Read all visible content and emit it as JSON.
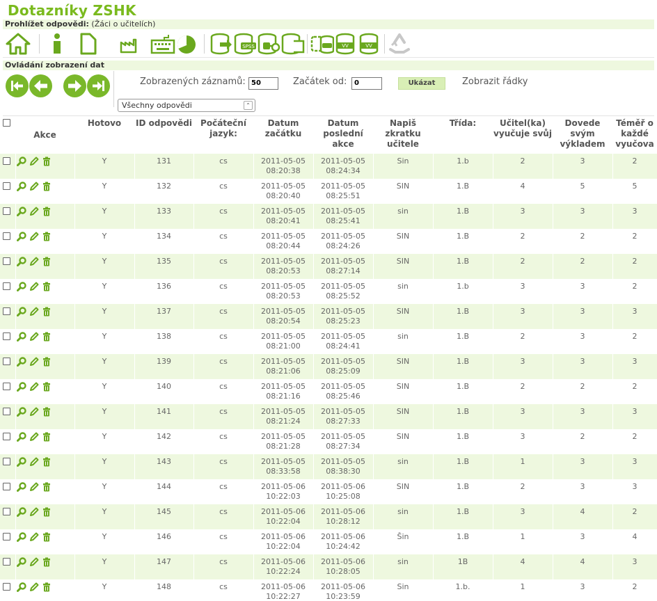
{
  "app_title": "Dotazníky ZSHK",
  "browse_bar": {
    "label": "Prohlížet odpovědi:",
    "context": "(Žáci o učitelích)"
  },
  "view_bar": {
    "label": "Ovládání zobrazení dat"
  },
  "controls": {
    "records_label": "Zobrazených záznamů:",
    "records_value": "50",
    "start_label": "Začátek od:",
    "start_value": "0",
    "show_button": "Ukázat",
    "rows_label": "Zobrazit řádky",
    "filter_selected": "Všechny odpovědi"
  },
  "colors": {
    "accent": "#7ab82a",
    "row_alt": "#eef8df",
    "title": "#7aba1e"
  },
  "toolbar_icons": [
    "home-icon",
    "info-icon",
    "document-icon",
    "factory-icon",
    "keyboard-icon",
    "pie-chart-icon",
    "export-database-icon",
    "spss-export-icon",
    "r-export-icon",
    "import-database-icon",
    "vv-database-icon",
    "vv-database-icon-2",
    "recycle-icon"
  ],
  "table": {
    "headers": [
      "Akce",
      "Hotovo",
      "ID odpovědi",
      "Počáteční jazyk:",
      "Datum začátku",
      "Datum poslední akce",
      "Napiš zkratku učitele",
      "Třída:",
      "Učitel(ka) vyučuje svůj",
      "Dovede svým výkladem",
      "Téměř o každé vyučova"
    ],
    "rows": [
      {
        "done": "Y",
        "id": "131",
        "lang": "cs",
        "start_d": "2011-05-05",
        "start_t": "08:20:38",
        "last_d": "2011-05-05",
        "last_t": "08:24:34",
        "teacher": "Sin",
        "class": "1.b",
        "q1": "2",
        "q2": "3",
        "q3": "2"
      },
      {
        "done": "Y",
        "id": "132",
        "lang": "cs",
        "start_d": "2011-05-05",
        "start_t": "08:20:40",
        "last_d": "2011-05-05",
        "last_t": "08:25:51",
        "teacher": "SIN",
        "class": "1.B",
        "q1": "4",
        "q2": "5",
        "q3": "5"
      },
      {
        "done": "Y",
        "id": "133",
        "lang": "cs",
        "start_d": "2011-05-05",
        "start_t": "08:20:41",
        "last_d": "2011-05-05",
        "last_t": "08:25:41",
        "teacher": "sin",
        "class": "1.B",
        "q1": "3",
        "q2": "3",
        "q3": "3"
      },
      {
        "done": "Y",
        "id": "134",
        "lang": "cs",
        "start_d": "2011-05-05",
        "start_t": "08:20:44",
        "last_d": "2011-05-05",
        "last_t": "08:24:26",
        "teacher": "SIN",
        "class": "1.B",
        "q1": "2",
        "q2": "2",
        "q3": "2"
      },
      {
        "done": "Y",
        "id": "135",
        "lang": "cs",
        "start_d": "2011-05-05",
        "start_t": "08:20:53",
        "last_d": "2011-05-05",
        "last_t": "08:27:14",
        "teacher": "SIN",
        "class": "1.B",
        "q1": "2",
        "q2": "2",
        "q3": "2"
      },
      {
        "done": "Y",
        "id": "136",
        "lang": "cs",
        "start_d": "2011-05-05",
        "start_t": "08:20:53",
        "last_d": "2011-05-05",
        "last_t": "08:25:52",
        "teacher": "sin",
        "class": "1.b",
        "q1": "3",
        "q2": "3",
        "q3": "2"
      },
      {
        "done": "Y",
        "id": "137",
        "lang": "cs",
        "start_d": "2011-05-05",
        "start_t": "08:20:54",
        "last_d": "2011-05-05",
        "last_t": "08:25:23",
        "teacher": "SIN",
        "class": "1.B",
        "q1": "3",
        "q2": "3",
        "q3": "3"
      },
      {
        "done": "Y",
        "id": "138",
        "lang": "cs",
        "start_d": "2011-05-05",
        "start_t": "08:21:00",
        "last_d": "2011-05-05",
        "last_t": "08:24:41",
        "teacher": "sin",
        "class": "1.B",
        "q1": "2",
        "q2": "3",
        "q3": "2"
      },
      {
        "done": "Y",
        "id": "139",
        "lang": "cs",
        "start_d": "2011-05-05",
        "start_t": "08:21:06",
        "last_d": "2011-05-05",
        "last_t": "08:25:09",
        "teacher": "SIN",
        "class": "1.B",
        "q1": "3",
        "q2": "3",
        "q3": "3"
      },
      {
        "done": "Y",
        "id": "140",
        "lang": "cs",
        "start_d": "2011-05-05",
        "start_t": "08:21:16",
        "last_d": "2011-05-05",
        "last_t": "08:25:46",
        "teacher": "SIN",
        "class": "1.B",
        "q1": "2",
        "q2": "2",
        "q3": "2"
      },
      {
        "done": "Y",
        "id": "141",
        "lang": "cs",
        "start_d": "2011-05-05",
        "start_t": "08:21:24",
        "last_d": "2011-05-05",
        "last_t": "08:27:33",
        "teacher": "SIN",
        "class": "1.B",
        "q1": "3",
        "q2": "3",
        "q3": "3"
      },
      {
        "done": "Y",
        "id": "142",
        "lang": "cs",
        "start_d": "2011-05-05",
        "start_t": "08:21:28",
        "last_d": "2011-05-05",
        "last_t": "08:27:34",
        "teacher": "SIN",
        "class": "1.B",
        "q1": "3",
        "q2": "2",
        "q3": "2"
      },
      {
        "done": "Y",
        "id": "143",
        "lang": "cs",
        "start_d": "2011-05-05",
        "start_t": "08:33:58",
        "last_d": "2011-05-05",
        "last_t": "08:38:30",
        "teacher": "sin",
        "class": "1.B",
        "q1": "1",
        "q2": "3",
        "q3": "3"
      },
      {
        "done": "Y",
        "id": "144",
        "lang": "cs",
        "start_d": "2011-05-06",
        "start_t": "10:22:03",
        "last_d": "2011-05-06",
        "last_t": "10:25:08",
        "teacher": "SIN",
        "class": "1.B",
        "q1": "2",
        "q2": "3",
        "q3": "3"
      },
      {
        "done": "Y",
        "id": "145",
        "lang": "cs",
        "start_d": "2011-05-06",
        "start_t": "10:22:04",
        "last_d": "2011-05-06",
        "last_t": "10:28:12",
        "teacher": "sin",
        "class": "1.B",
        "q1": "3",
        "q2": "4",
        "q3": "2"
      },
      {
        "done": "Y",
        "id": "146",
        "lang": "cs",
        "start_d": "2011-05-06",
        "start_t": "10:22:04",
        "last_d": "2011-05-06",
        "last_t": "10:24:42",
        "teacher": "Šin",
        "class": "1.B",
        "q1": "1",
        "q2": "3",
        "q3": "4"
      },
      {
        "done": "Y",
        "id": "147",
        "lang": "cs",
        "start_d": "2011-05-06",
        "start_t": "10:22:24",
        "last_d": "2011-05-06",
        "last_t": "10:28:05",
        "teacher": "sin",
        "class": "1B",
        "q1": "4",
        "q2": "4",
        "q3": "3"
      },
      {
        "done": "Y",
        "id": "148",
        "lang": "cs",
        "start_d": "2011-05-06",
        "start_t": "10:22:27",
        "last_d": "2011-05-06",
        "last_t": "10:23:59",
        "teacher": "Sin",
        "class": "1.b.",
        "q1": "1",
        "q2": "3",
        "q3": "2"
      }
    ]
  }
}
